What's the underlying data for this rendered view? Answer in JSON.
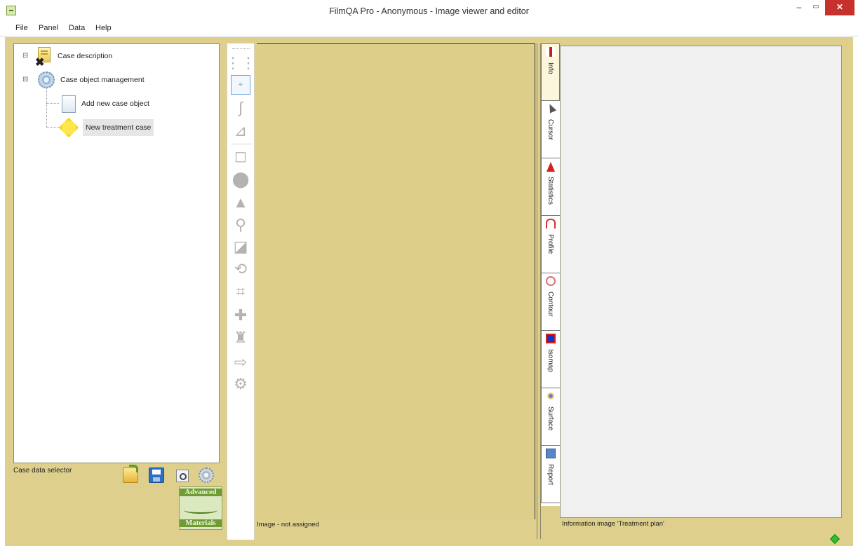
{
  "window": {
    "title": "FilmQA Pro - Anonymous - Image viewer and editor",
    "controls": {
      "minimize": "–",
      "maximize": "▭",
      "close": "✕"
    }
  },
  "menu": {
    "items": [
      {
        "label": "File"
      },
      {
        "label": "Panel"
      },
      {
        "label": "Data"
      },
      {
        "label": "Help"
      }
    ]
  },
  "case_tree": {
    "nodes": [
      {
        "label": "Case description",
        "icon": "case-description-icon",
        "expander": "⊟"
      },
      {
        "label": "Case object management",
        "icon": "gear-icon",
        "expander": "⊟"
      },
      {
        "label": "Add new case object",
        "icon": "document-icon"
      },
      {
        "label": "New treatment case",
        "icon": "treatment-case-icon",
        "selected": true
      }
    ]
  },
  "case_footer": {
    "label": "Case data selector",
    "buttons": [
      {
        "name": "open-case-button",
        "icon": "folder-icon"
      },
      {
        "name": "save-case-button",
        "icon": "save-icon"
      },
      {
        "name": "inspect-case-button",
        "icon": "magnifier-icon"
      },
      {
        "name": "case-settings-button",
        "icon": "gear-icon"
      }
    ],
    "logo_text": [
      "Advanced",
      "Materials"
    ]
  },
  "tools": [
    {
      "name": "grid-tool",
      "icon": "grid-icon",
      "glyph": "⋮⋮"
    },
    {
      "name": "point-tool",
      "icon": "crosshair-icon",
      "glyph": "⌖",
      "active": true
    },
    {
      "name": "curve-tool",
      "icon": "curve-icon",
      "glyph": "∫"
    },
    {
      "name": "calibrate-tool",
      "icon": "scale-icon",
      "glyph": "⊿"
    },
    {
      "name": "region-tool",
      "icon": "region-icon",
      "glyph": "◻"
    },
    {
      "name": "spots-tool",
      "icon": "spots-icon",
      "glyph": "⬤"
    },
    {
      "name": "peak-tool",
      "icon": "triangle-icon",
      "glyph": "▲"
    },
    {
      "name": "zoom-tool",
      "icon": "zoom-icon",
      "glyph": "⚲"
    },
    {
      "name": "flatten-tool",
      "icon": "flatten-icon",
      "glyph": "◪"
    },
    {
      "name": "rotate-tool",
      "icon": "rotate-icon",
      "glyph": "⟲"
    },
    {
      "name": "crop-tool",
      "icon": "crop-icon",
      "glyph": "⌗"
    },
    {
      "name": "add-tool",
      "icon": "plus-icon",
      "glyph": "✚"
    },
    {
      "name": "filter-tool",
      "icon": "filter-icon",
      "glyph": "♜"
    },
    {
      "name": "export-tool",
      "icon": "export-icon",
      "glyph": "⇨"
    },
    {
      "name": "settings-tool",
      "icon": "gear-icon",
      "glyph": "⚙"
    }
  ],
  "viewer": {
    "status": "Image - not assigned"
  },
  "side_tabs": [
    {
      "label": "Info",
      "icon": "info-icon",
      "active": true
    },
    {
      "label": "Cursor",
      "icon": "cursor-icon"
    },
    {
      "label": "Statistics",
      "icon": "statistics-icon"
    },
    {
      "label": "Profile",
      "icon": "profile-icon"
    },
    {
      "label": "Contour",
      "icon": "contour-icon"
    },
    {
      "label": "Isomap",
      "icon": "isomap-icon"
    },
    {
      "label": "Surface",
      "icon": "surface-icon"
    },
    {
      "label": "Report",
      "icon": "report-icon"
    }
  ],
  "info_panel": {
    "status": "Information image 'Treatment plan'"
  },
  "colors": {
    "workspace": "#ded08c",
    "close_button": "#c7312b",
    "status_ok": "#2cc02c"
  }
}
